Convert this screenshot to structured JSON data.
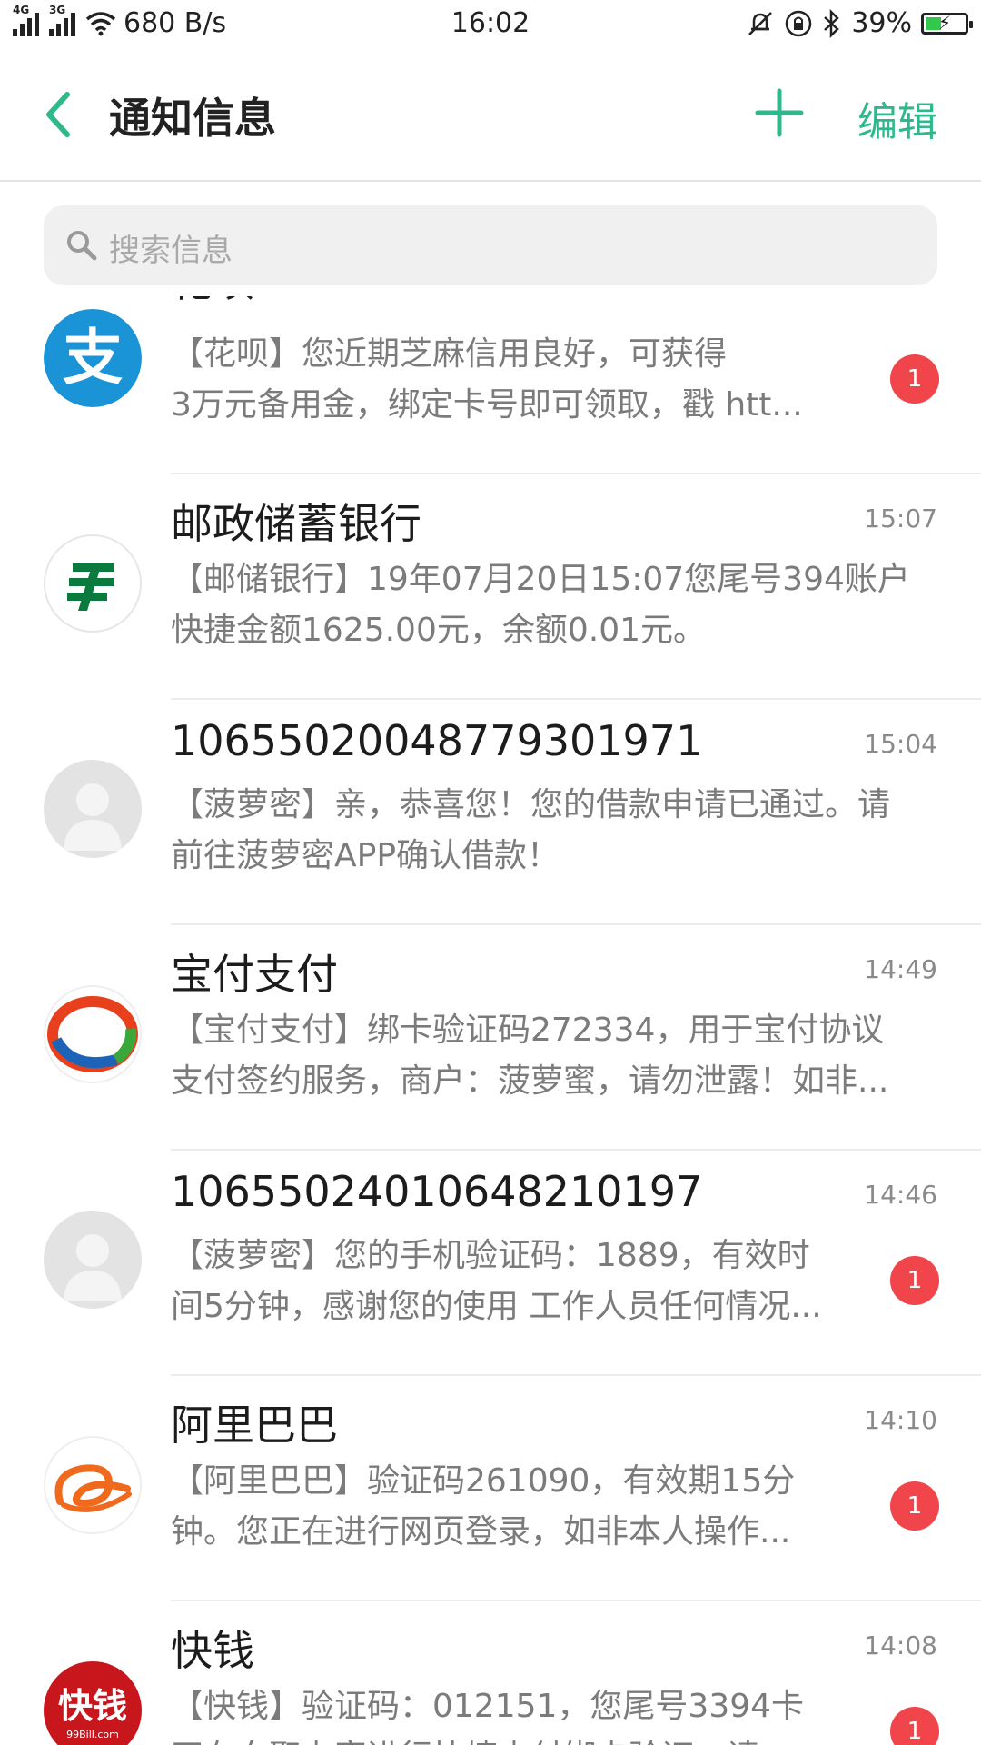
{
  "status_bar": {
    "net1": "4G",
    "net2": "3G",
    "speed": "680 B/s",
    "time": "16:02",
    "battery": "39%"
  },
  "header": {
    "title": "通知信息",
    "edit_label": "编辑"
  },
  "search": {
    "placeholder": "搜索信息"
  },
  "colors": {
    "accent": "#2fb88c",
    "badge": "#f0464b"
  },
  "messages": [
    {
      "name": "花呗",
      "time": "",
      "line1": "【花呗】您近期芝麻信用良好，可获得",
      "line2": "3万元备用金，绑定卡号即可领取，戳 htt...",
      "badge": "1",
      "avatar": "alipay-icon"
    },
    {
      "name": "邮政储蓄银行",
      "time": "15:07",
      "line1": "【邮储银行】19年07月20日15:07您尾号394账户",
      "line2": "快捷金额1625.00元，余额0.01元。",
      "badge": "",
      "avatar": "postal-bank-icon"
    },
    {
      "name": "10655020048779301971",
      "time": "15:04",
      "line1": "【菠萝密】亲，恭喜您！您的借款申请已通过。请",
      "line2": "前往菠萝密APP确认借款！",
      "badge": "",
      "avatar": "default-contact-icon"
    },
    {
      "name": "宝付支付",
      "time": "14:49",
      "line1": "【宝付支付】绑卡验证码272334，用于宝付协议",
      "line2": "支付签约服务，商户：菠萝蜜，请勿泄露！如非...",
      "badge": "",
      "avatar": "baofu-icon"
    },
    {
      "name": "10655024010648210197",
      "time": "14:46",
      "line1": "【菠萝密】您的手机验证码：1889，有效时",
      "line2": "间5分钟，感谢您的使用 工作人员任何情况...",
      "badge": "1",
      "avatar": "default-contact-icon"
    },
    {
      "name": "阿里巴巴",
      "time": "14:10",
      "line1": "【阿里巴巴】验证码261090，有效期15分",
      "line2": "钟。您正在进行网页登录，如非本人操作...",
      "badge": "1",
      "avatar": "alibaba-icon"
    },
    {
      "name": "快钱",
      "time": "14:08",
      "line1": "【快钱】验证码：012151，您尾号3394卡",
      "line2": "正在向聚力富进行快捷支付绑卡验证，请...",
      "badge": "1",
      "avatar": "kuaiqian-icon",
      "avatar_text": "快钱",
      "avatar_subtext": "99Bill.com"
    }
  ]
}
